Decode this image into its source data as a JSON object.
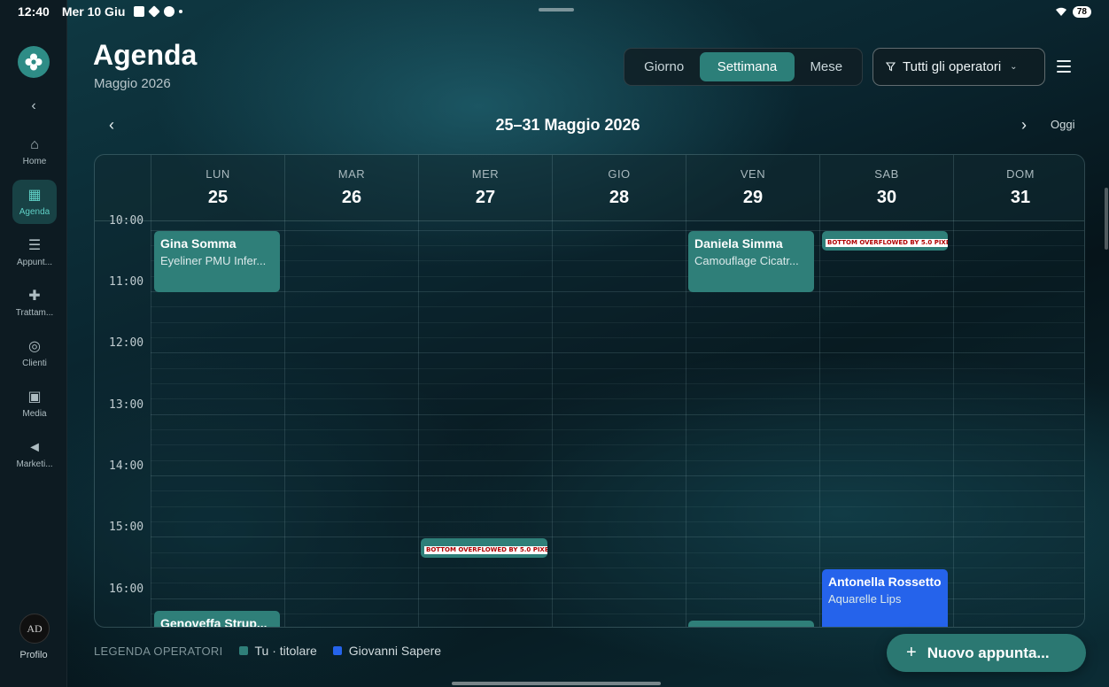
{
  "status_bar": {
    "time": "12:40",
    "date": "Mer 10 Giu",
    "battery": "78"
  },
  "sidebar": {
    "items": [
      {
        "label": "Home",
        "icon": "home-icon",
        "active": false
      },
      {
        "label": "Agenda",
        "icon": "calendar-icon",
        "active": true
      },
      {
        "label": "Appunt...",
        "icon": "clipboard-icon",
        "active": false
      },
      {
        "label": "Trattam...",
        "icon": "bandage-icon",
        "active": false
      },
      {
        "label": "Clienti",
        "icon": "users-icon",
        "active": false
      },
      {
        "label": "Media",
        "icon": "gallery-icon",
        "active": false
      },
      {
        "label": "Marketi...",
        "icon": "megaphone-icon",
        "active": false
      }
    ],
    "profile_initials": "AD",
    "profile_label": "Profilo"
  },
  "header": {
    "title": "Agenda",
    "subtitle": "Maggio 2026",
    "views": [
      "Giorno",
      "Settimana",
      "Mese"
    ],
    "active_view": "Settimana",
    "filter_label": "Tutti gli operatori"
  },
  "week_nav": {
    "title": "25–31 Maggio 2026",
    "today_label": "Oggi"
  },
  "calendar": {
    "days": [
      {
        "name": "LUN",
        "date": "25"
      },
      {
        "name": "MAR",
        "date": "26"
      },
      {
        "name": "MER",
        "date": "27"
      },
      {
        "name": "GIO",
        "date": "28"
      },
      {
        "name": "VEN",
        "date": "29"
      },
      {
        "name": "SAB",
        "date": "30"
      },
      {
        "name": "DOM",
        "date": "31"
      }
    ],
    "hours": [
      "10:00",
      "11:00",
      "12:00",
      "13:00",
      "14:00",
      "15:00",
      "16:00"
    ],
    "events": [
      {
        "day": "LUN",
        "start": "10:00",
        "end": "11:00",
        "title": "Gina Somma",
        "subtitle": "Eyeliner PMU Infer...",
        "operator": "Tu · titolare"
      },
      {
        "day": "VEN",
        "start": "10:00",
        "end": "11:00",
        "title": "Daniela Simma",
        "subtitle": "Camouflage Cicatr...",
        "operator": "Tu · titolare"
      },
      {
        "day": "SAB",
        "start": "10:00",
        "end": "10:20",
        "overflow_text": "BOTTOM OVERFLOWED BY 5.0 PIXELS",
        "operator": "Tu · titolare"
      },
      {
        "day": "MER",
        "start": "15:00",
        "end": "15:20",
        "overflow_text": "BOTTOM OVERFLOWED BY 5.0 PIXELS",
        "operator": "Tu · titolare"
      },
      {
        "day": "SAB",
        "start": "15:20",
        "end": "16:30",
        "title": "Antonella Rossetto",
        "subtitle": "Aquarelle Lips",
        "operator": "Giovanni Sapere"
      },
      {
        "day": "LUN",
        "start": "16:00",
        "end": "16:30",
        "title": "Genoveffa Strup...",
        "subtitle": "",
        "operator": "Tu · titolare"
      }
    ]
  },
  "legend": {
    "title": "LEGENDA OPERATORI",
    "items": [
      {
        "label": "Tu · titolare",
        "color": "#2f7f79"
      },
      {
        "label": "Giovanni Sapere",
        "color": "#2563eb"
      }
    ]
  },
  "fab": {
    "label": "Nuovo appunta..."
  },
  "colors": {
    "accent": "#2c7f79",
    "operator_blue": "#2563eb",
    "sidebar_bg": "#0d1b22"
  }
}
